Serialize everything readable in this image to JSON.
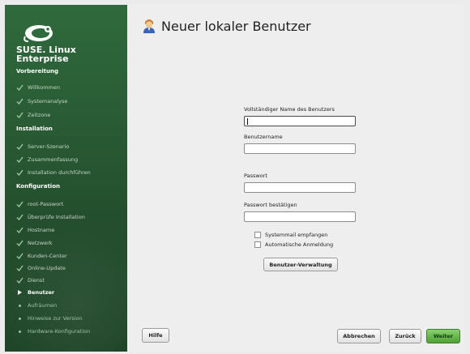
{
  "brand": {
    "line1": "SUSE. Linux",
    "line2": "Enterprise",
    "logo_icon": "suse-chameleon-icon"
  },
  "sidebar": {
    "sections": [
      {
        "label": "Vorbereitung"
      },
      {
        "label": "Installation"
      },
      {
        "label": "Konfiguration"
      }
    ],
    "items": [
      {
        "label": "Willkommen",
        "state": "done"
      },
      {
        "label": "Systemanalyse",
        "state": "done"
      },
      {
        "label": "Zeitzone",
        "state": "done"
      },
      {
        "label": "Server-Szenario",
        "state": "done"
      },
      {
        "label": "Zusammenfassung",
        "state": "done"
      },
      {
        "label": "Installation durchführen",
        "state": "done"
      },
      {
        "label": "root-Passwort",
        "state": "done"
      },
      {
        "label": "Überprüfe Installation",
        "state": "done"
      },
      {
        "label": "Hostname",
        "state": "done"
      },
      {
        "label": "Netzwerk",
        "state": "done"
      },
      {
        "label": "Kunden-Center",
        "state": "done"
      },
      {
        "label": "Online-Update",
        "state": "done"
      },
      {
        "label": "Dienst",
        "state": "done"
      },
      {
        "label": "Benutzer",
        "state": "current"
      },
      {
        "label": "Aufräumen",
        "state": "todo"
      },
      {
        "label": "Hinweise zur Version",
        "state": "todo"
      },
      {
        "label": "Hardware-Konfiguration",
        "state": "todo"
      }
    ]
  },
  "page": {
    "title": "Neuer lokaler Benutzer",
    "icon": "user-icon"
  },
  "form": {
    "fullname_label": "Vollständiger Name des Benutzers",
    "fullname_value": "",
    "username_label": "Benutzername",
    "username_value": "",
    "password_label": "Passwort",
    "password_value": "",
    "confirm_label": "Passwort bestätigen",
    "confirm_value": "",
    "systemmail_label": "Systemmail empfangen",
    "systemmail_checked": false,
    "autologin_label": "Automatische Anmeldung",
    "autologin_checked": false,
    "manage_users_label": "Benutzer-Verwaltung"
  },
  "footer": {
    "help_label": "Hilfe",
    "abort_label": "Abbrechen",
    "back_label": "Zurück",
    "next_label": "Weiter"
  },
  "colors": {
    "sidebar": "#2a5d35",
    "accent": "#6ec04f",
    "main_bg": "#eeeeee"
  }
}
